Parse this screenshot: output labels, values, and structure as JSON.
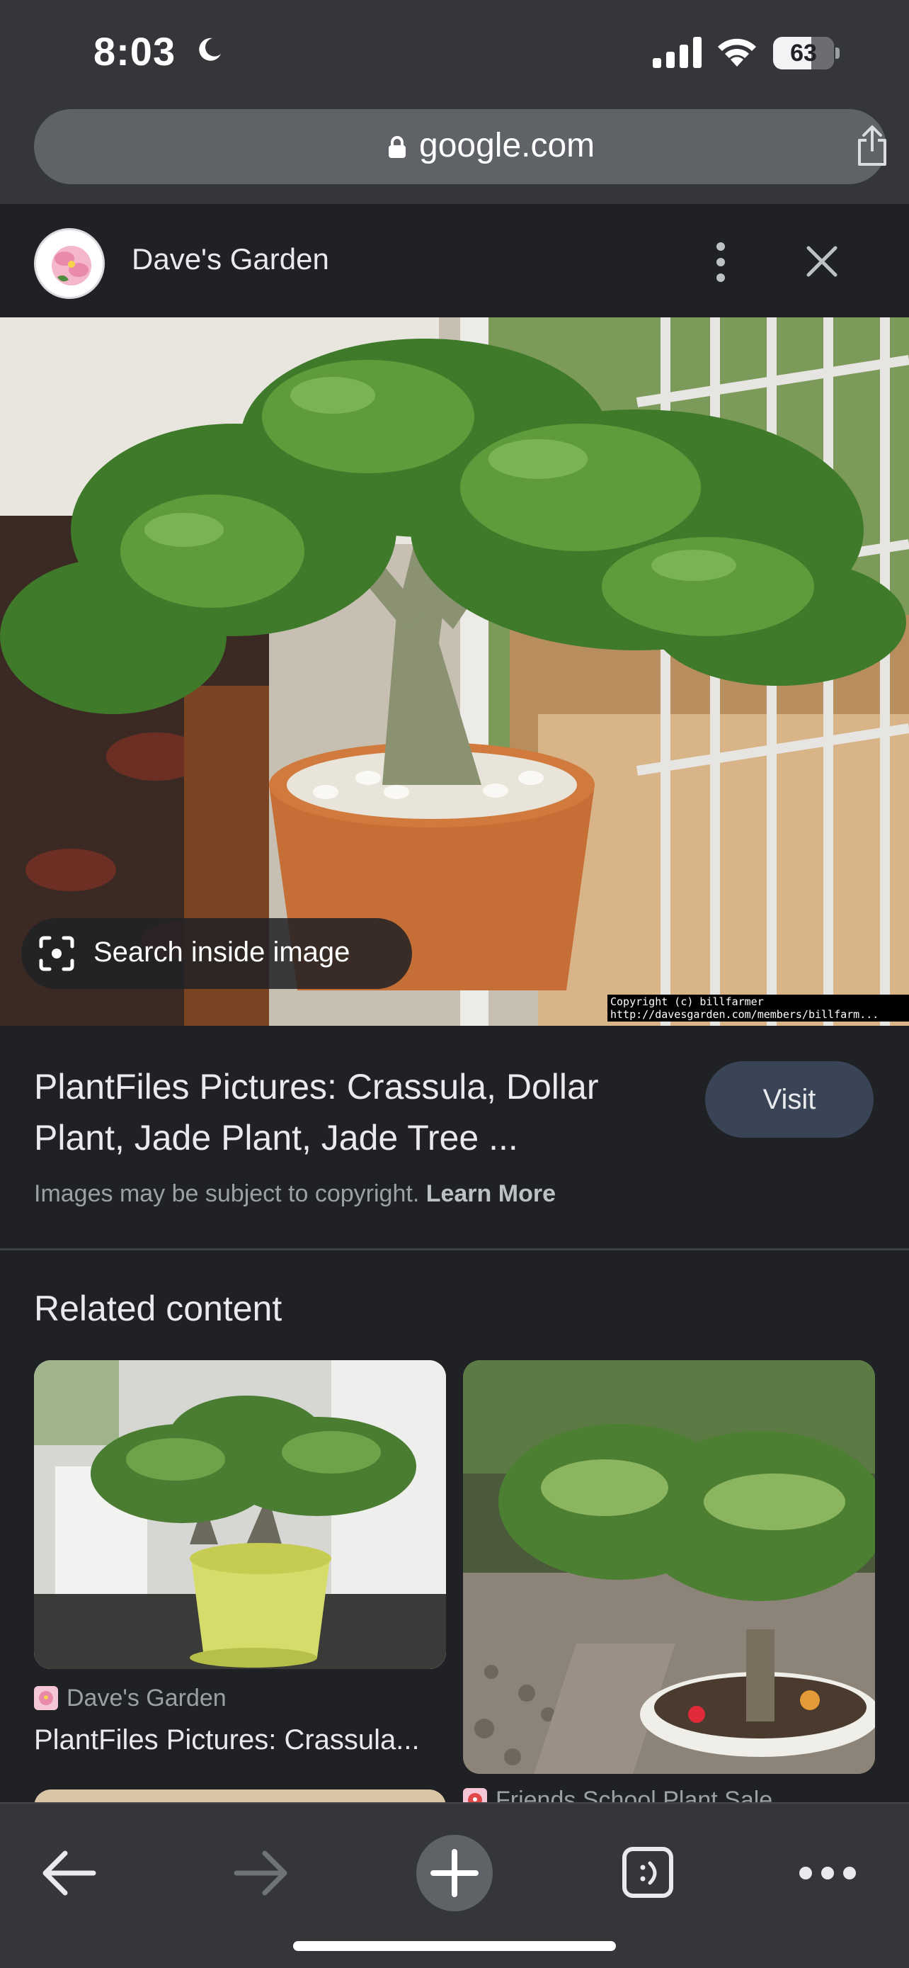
{
  "status_bar": {
    "time": "8:03",
    "battery_level": "63",
    "battery_fraction": 0.63,
    "icons": [
      "moon-icon",
      "cellular-signal-icon",
      "wifi-icon",
      "battery-icon"
    ]
  },
  "url_bar": {
    "url": "google.com",
    "icons": [
      "lock-icon",
      "share-icon"
    ]
  },
  "source": {
    "name": "Dave's Garden",
    "icons": [
      "more-vert-icon",
      "close-icon"
    ]
  },
  "image_viewer": {
    "search_inside_label": "Search inside image",
    "watermark": "Copyright (c) billfarmer\nhttp://davesgarden.com/members/billfarm..."
  },
  "result": {
    "title": "PlantFiles Pictures: Crassula, Dollar Plant, Jade Plant, Jade Tree ...",
    "visit_label": "Visit",
    "copyright_note": "Images may be subject to copyright.",
    "learn_more_label": "Learn More"
  },
  "related": {
    "heading": "Related content",
    "cards": [
      {
        "source": "Dave's Garden",
        "title": "PlantFiles Pictures: Crassula..."
      },
      {
        "source": "Friends School Plant Sale",
        "title": ""
      }
    ]
  },
  "toolbar": {
    "icons": [
      "back-arrow-icon",
      "forward-arrow-icon",
      "plus-icon",
      "tabs-icon",
      "more-horiz-icon"
    ]
  },
  "colors": {
    "chrome_bg": "#35363a",
    "page_bg": "#202124",
    "visit_button": "#394457",
    "text_primary": "#e8eaed",
    "text_secondary": "#9aa0a6"
  }
}
